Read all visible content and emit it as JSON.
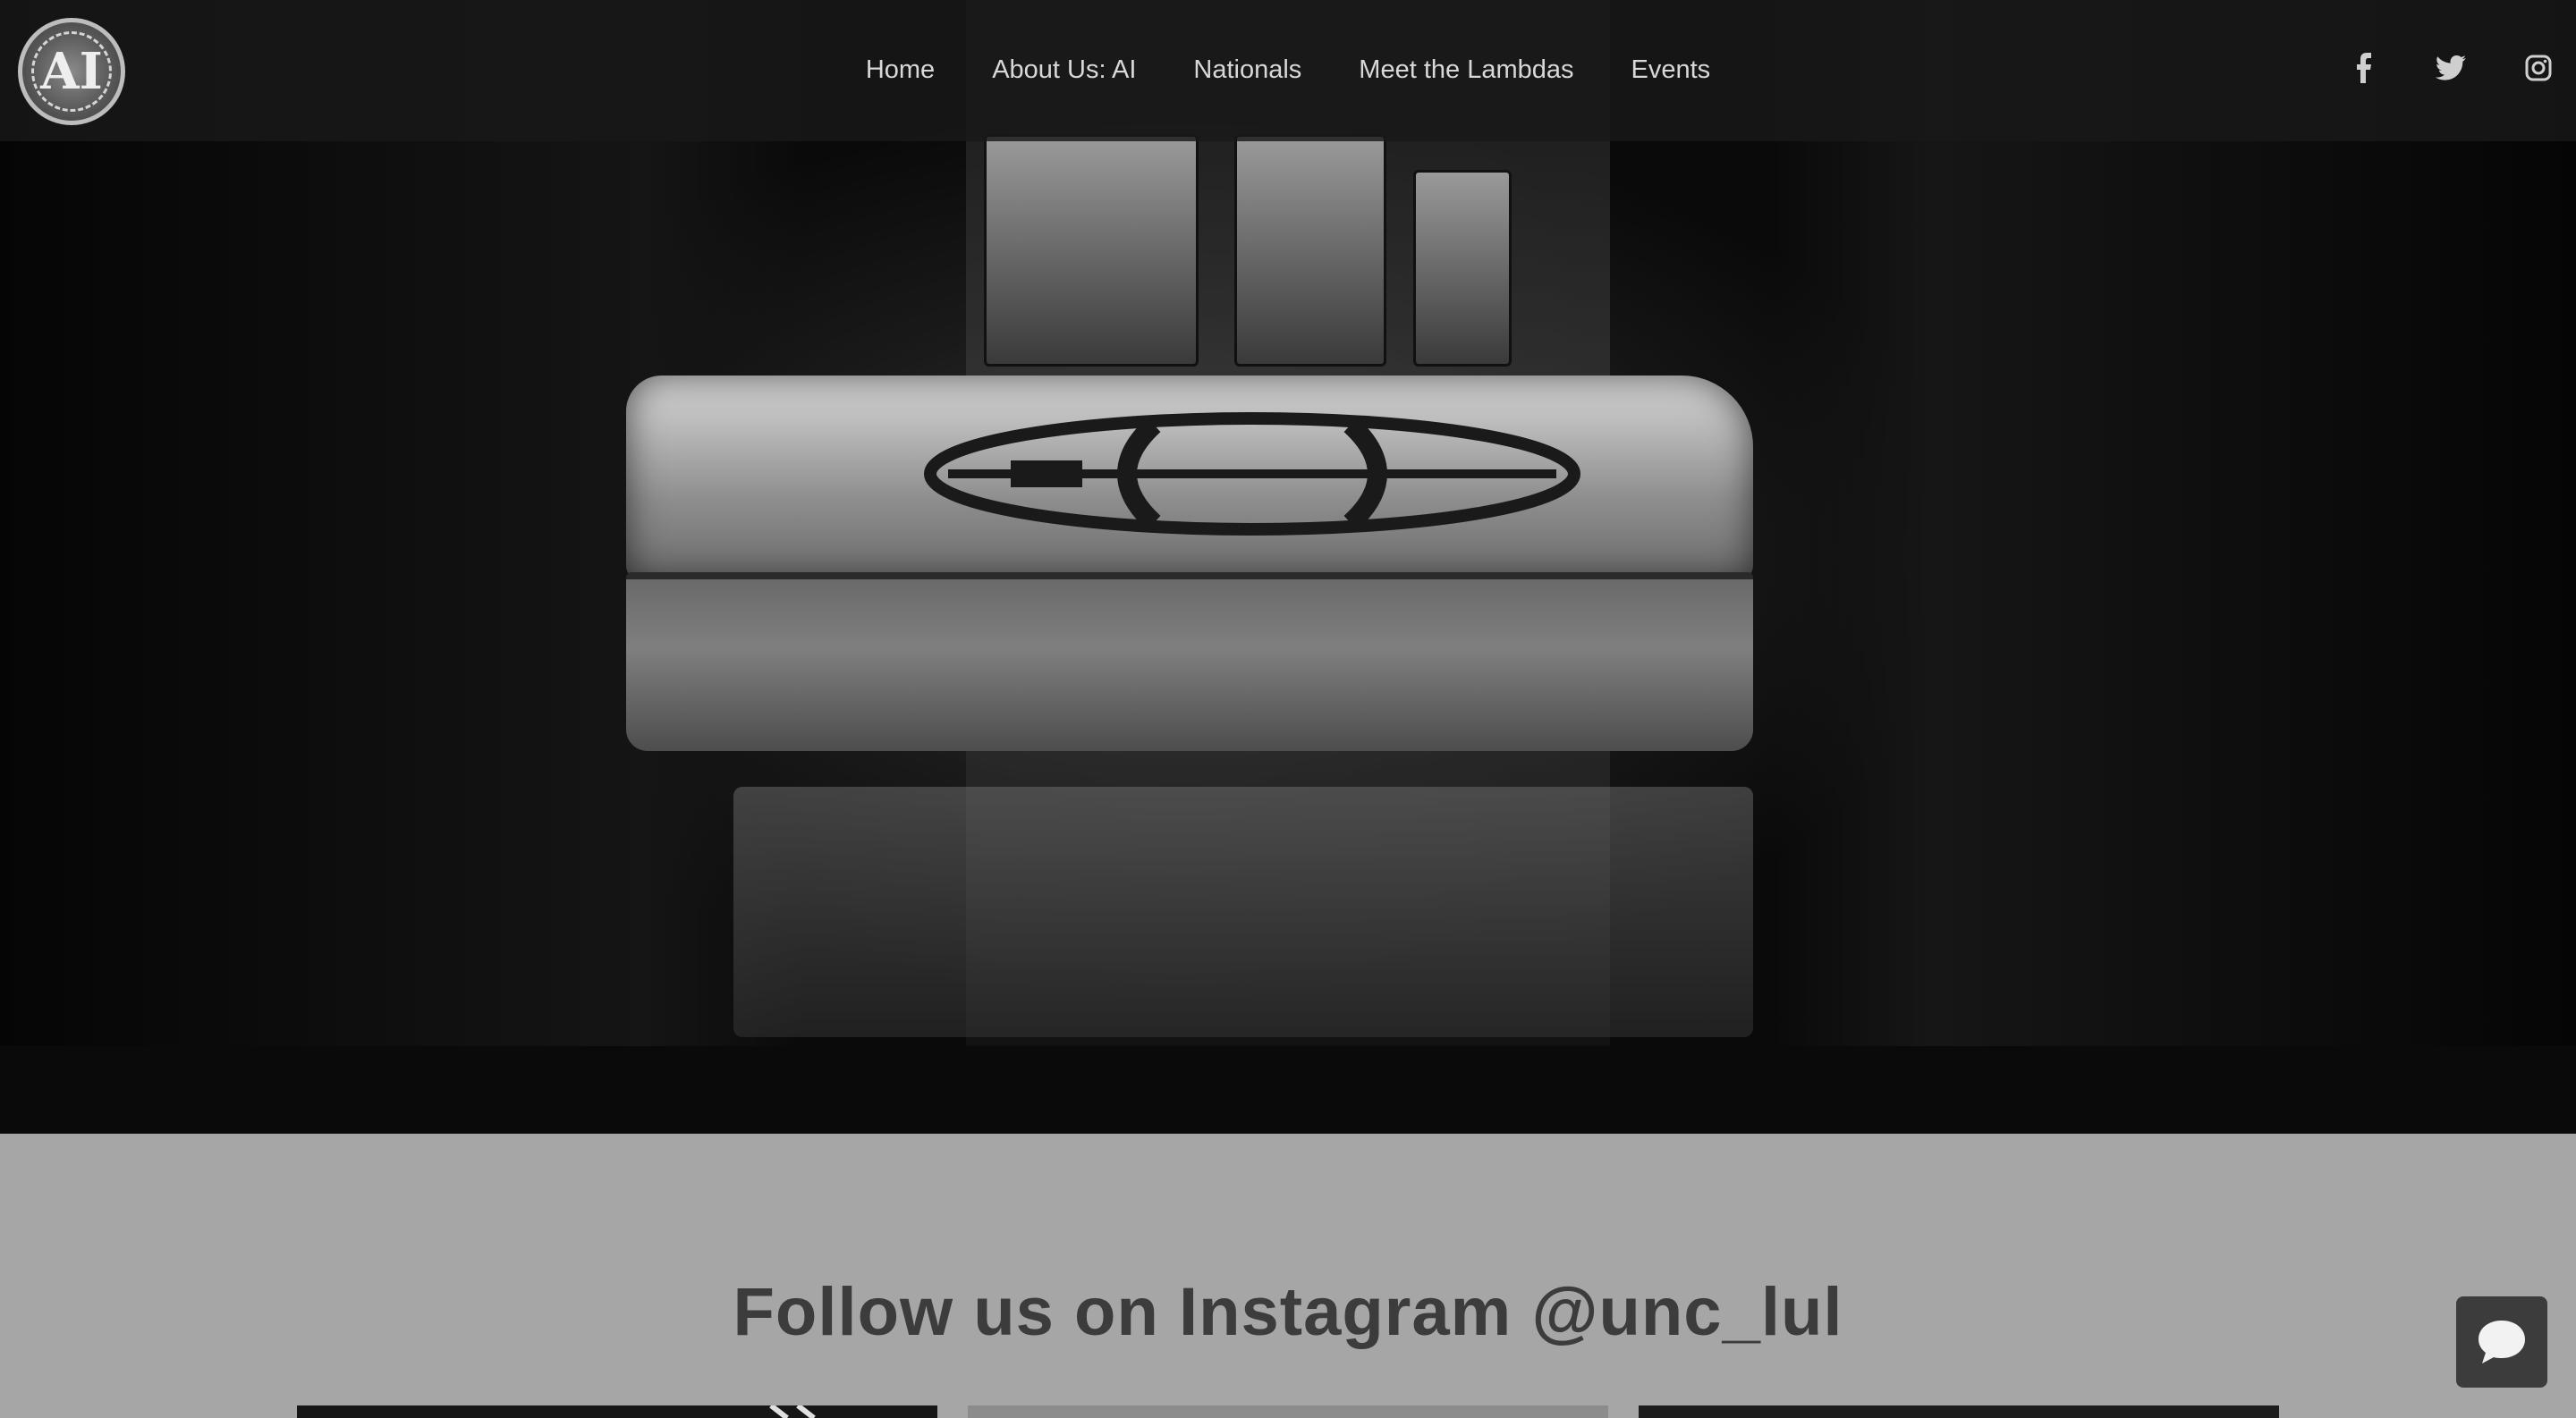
{
  "header": {
    "logo_text": "AI",
    "nav": [
      {
        "label": "Home"
      },
      {
        "label": "About Us: AI"
      },
      {
        "label": "Nationals"
      },
      {
        "label": "Meet the Lambdas"
      },
      {
        "label": "Events"
      }
    ],
    "social_icons": [
      "facebook-icon",
      "twitter-icon",
      "instagram-icon"
    ]
  },
  "hero": {
    "image": "metal emblem tag on dark surface"
  },
  "instagram": {
    "heading": "Follow us on Instagram @unc_lul"
  },
  "chat": {
    "icon": "chat-bubble-icon"
  },
  "colors": {
    "header_bg": "#191919",
    "section_bg": "#a6a6a6",
    "heading": "#3c3c3c",
    "chat_bg": "#3c3c3c"
  }
}
